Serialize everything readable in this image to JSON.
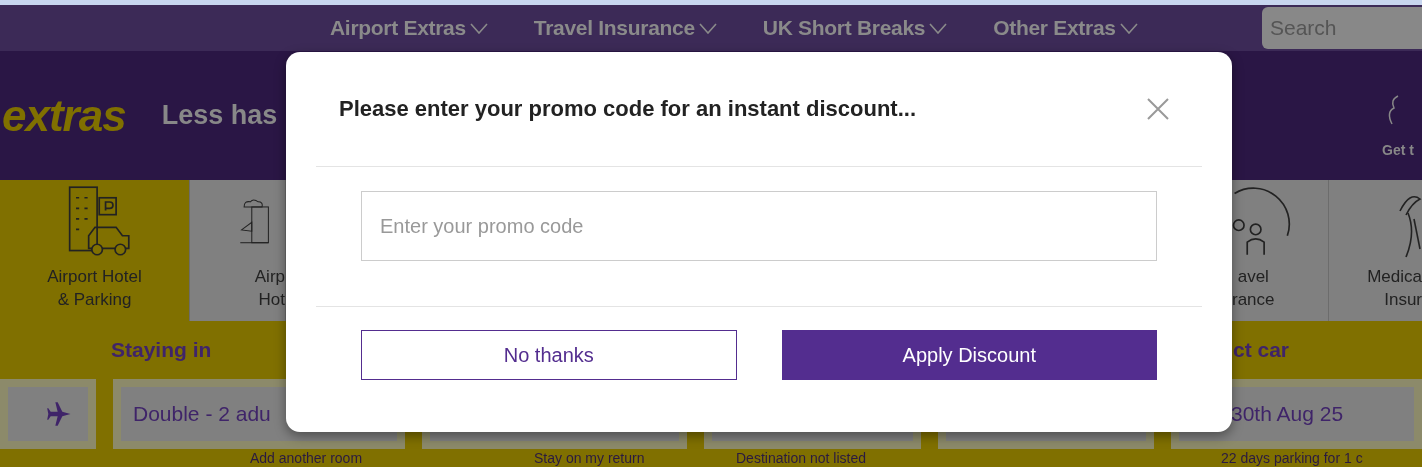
{
  "nav": {
    "items": [
      {
        "label": "Airport Extras"
      },
      {
        "label": "Travel Insurance"
      },
      {
        "label": "UK Short Breaks"
      },
      {
        "label": "Other Extras"
      }
    ],
    "search": {
      "placeholder": "Search"
    }
  },
  "header": {
    "logo": "extras",
    "tagline": "Less has",
    "side_label": "Get t"
  },
  "categories": [
    {
      "kind": "hotel-parking",
      "lines": [
        "Airport Hotel",
        "& Parking"
      ],
      "selected": true
    },
    {
      "kind": "hotel",
      "lines": [
        "Airp",
        "Hot"
      ],
      "selected": false
    },
    {
      "kind": "travel",
      "lines": [
        "avel",
        "rance"
      ],
      "selected": false
    },
    {
      "kind": "medical",
      "lines": [
        "Medica",
        "Insur"
      ],
      "selected": false
    }
  ],
  "form": {
    "headings": [
      "Staying in",
      "ct car"
    ],
    "fields": [
      {
        "kind": "airport"
      },
      {
        "kind": "text",
        "value": "Double - 2 adu",
        "hint": "Add another room"
      },
      {
        "kind": "empty",
        "hint": "Stay on my return"
      },
      {
        "kind": "empty",
        "hint": "Destination not listed"
      },
      {
        "kind": "empty"
      },
      {
        "kind": "text",
        "value": "30th Aug 25",
        "hint": "22 days parking for 1 c"
      }
    ]
  },
  "modal": {
    "title": "Please enter your promo code for an instant discount...",
    "input": {
      "placeholder": "Enter your promo code"
    },
    "buttons": [
      {
        "kind": "secondary",
        "label": "No thanks"
      },
      {
        "kind": "primary",
        "label": "Apply Discount"
      }
    ]
  }
}
